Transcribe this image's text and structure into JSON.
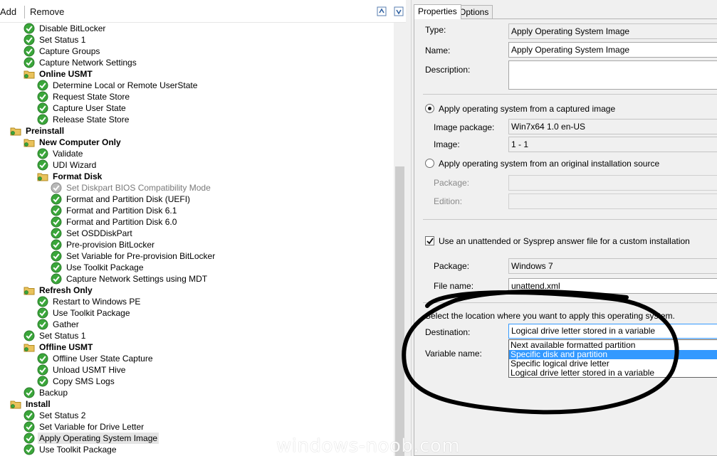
{
  "toolbar": {
    "add_label": "Add",
    "remove_label": "Remove",
    "icons": [
      "move-up-icon",
      "move-down-icon"
    ]
  },
  "tree": [
    {
      "label": "Disable BitLocker",
      "type": "step",
      "level": 1,
      "status": "ok"
    },
    {
      "label": "Set Status 1",
      "type": "step",
      "level": 1,
      "status": "ok"
    },
    {
      "label": "Capture Groups",
      "type": "step",
      "level": 1,
      "status": "ok"
    },
    {
      "label": "Capture Network Settings",
      "type": "step",
      "level": 1,
      "status": "ok"
    },
    {
      "label": "Online USMT",
      "type": "group",
      "level": 1
    },
    {
      "label": "Determine Local or Remote UserState",
      "type": "step",
      "level": 2,
      "status": "ok"
    },
    {
      "label": "Request State Store",
      "type": "step",
      "level": 2,
      "status": "ok"
    },
    {
      "label": "Capture User State",
      "type": "step",
      "level": 2,
      "status": "ok"
    },
    {
      "label": "Release State Store",
      "type": "step",
      "level": 2,
      "status": "ok"
    },
    {
      "label": "Preinstall",
      "type": "group",
      "level": 0
    },
    {
      "label": "New Computer Only",
      "type": "group",
      "level": 1
    },
    {
      "label": "Validate",
      "type": "step",
      "level": 2,
      "status": "ok"
    },
    {
      "label": "UDI Wizard",
      "type": "step",
      "level": 2,
      "status": "ok"
    },
    {
      "label": "Format Disk",
      "type": "group",
      "level": 2
    },
    {
      "label": "Set Diskpart BIOS Compatibility Mode",
      "type": "step",
      "level": 3,
      "status": "disabled"
    },
    {
      "label": "Format and Partition Disk (UEFI)",
      "type": "step",
      "level": 3,
      "status": "ok"
    },
    {
      "label": "Format and Partition Disk 6.1",
      "type": "step",
      "level": 3,
      "status": "ok"
    },
    {
      "label": "Format and Partition Disk 6.0",
      "type": "step",
      "level": 3,
      "status": "ok"
    },
    {
      "label": "Set OSDDiskPart",
      "type": "step",
      "level": 3,
      "status": "ok"
    },
    {
      "label": "Pre-provision BitLocker",
      "type": "step",
      "level": 3,
      "status": "ok"
    },
    {
      "label": "Set Variable for Pre-provision BitLocker",
      "type": "step",
      "level": 3,
      "status": "ok"
    },
    {
      "label": "Use Toolkit Package",
      "type": "step",
      "level": 3,
      "status": "ok"
    },
    {
      "label": "Capture Network Settings using MDT",
      "type": "step",
      "level": 3,
      "status": "ok"
    },
    {
      "label": "Refresh Only",
      "type": "group",
      "level": 1
    },
    {
      "label": "Restart to Windows PE",
      "type": "step",
      "level": 2,
      "status": "ok"
    },
    {
      "label": "Use Toolkit Package",
      "type": "step",
      "level": 2,
      "status": "ok"
    },
    {
      "label": "Gather",
      "type": "step",
      "level": 2,
      "status": "ok"
    },
    {
      "label": "Set Status 1",
      "type": "step",
      "level": 1,
      "status": "ok"
    },
    {
      "label": "Offline USMT",
      "type": "group",
      "level": 1
    },
    {
      "label": "Offline User State Capture",
      "type": "step",
      "level": 2,
      "status": "ok"
    },
    {
      "label": "Unload USMT Hive",
      "type": "step",
      "level": 2,
      "status": "ok"
    },
    {
      "label": "Copy SMS Logs",
      "type": "step",
      "level": 2,
      "status": "ok"
    },
    {
      "label": "Backup",
      "type": "step",
      "level": 1,
      "status": "ok"
    },
    {
      "label": "Install",
      "type": "group",
      "level": 0
    },
    {
      "label": "Set Status 2",
      "type": "step",
      "level": 1,
      "status": "ok"
    },
    {
      "label": "Set Variable for Drive Letter",
      "type": "step",
      "level": 1,
      "status": "ok"
    },
    {
      "label": "Apply Operating System Image",
      "type": "step",
      "level": 1,
      "status": "ok",
      "selected": true
    },
    {
      "label": "Use Toolkit Package",
      "type": "step",
      "level": 1,
      "status": "ok"
    }
  ],
  "tabs": {
    "properties": "Properties",
    "options": "Options"
  },
  "properties": {
    "type_label": "Type:",
    "type_value": "Apply Operating System Image",
    "name_label": "Name:",
    "name_value": "Apply Operating System Image",
    "description_label": "Description:",
    "description_value": "",
    "radio_captured": "Apply operating system from a captured image",
    "image_package_label": "Image package:",
    "image_package_value": "Win7x64 1.0 en-US",
    "image_label": "Image:",
    "image_value": "1 - 1",
    "radio_original": "Apply operating system from an original installation source",
    "package_label": "Package:",
    "edition_label": "Edition:",
    "unattend_checkbox": "Use an unattended or Sysprep answer file for a custom installation",
    "unattend_package_label": "Package:",
    "unattend_package_value": "Windows 7",
    "file_name_label": "File name:",
    "file_name_value": "unattend.xml",
    "location_text": "Select the location where you want to apply this operating system.",
    "destination_label": "Destination:",
    "destination_value": "Logical drive letter stored in a variable",
    "destination_options": [
      "Next available formatted partition",
      "Specific disk and partition",
      "Specific logical drive letter",
      "Logical drive letter stored in a variable"
    ],
    "destination_highlighted": 1,
    "variable_name_label": "Variable name:"
  },
  "colors": {
    "check_green": "#3aa63a",
    "folder_yellow": "#e9c25b",
    "selection_blue": "#3399ff",
    "annotation_ink": "#000000"
  },
  "watermark": "windows-noob.com"
}
